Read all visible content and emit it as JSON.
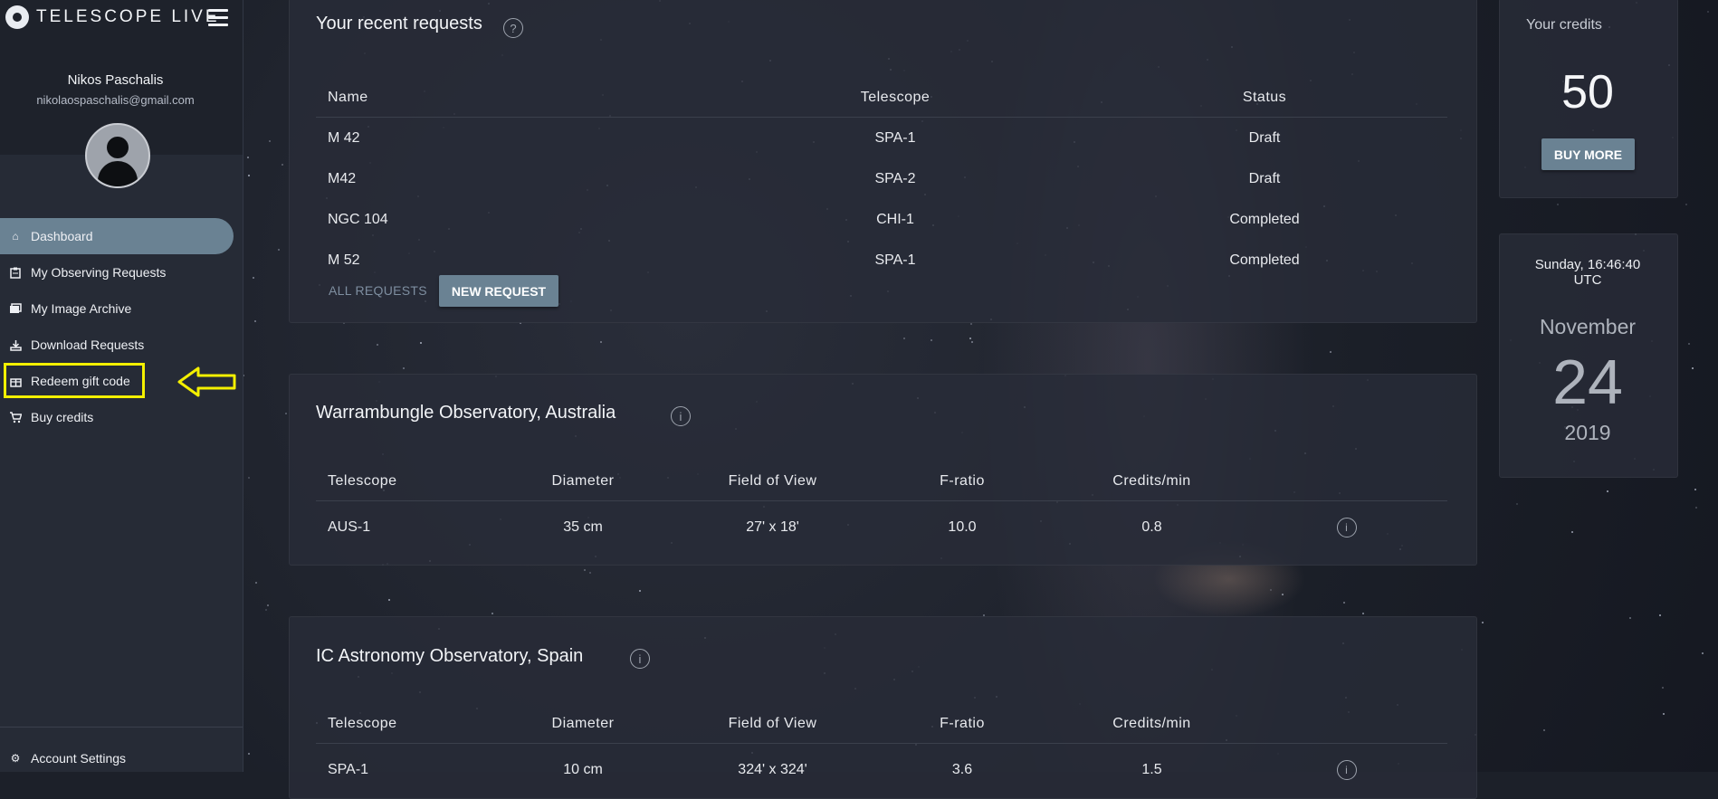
{
  "app": {
    "logo_text": "TELESCOPE LIVE"
  },
  "user": {
    "name": "Nikos Paschalis",
    "email": "nikolaospaschalis@gmail.com"
  },
  "nav": {
    "items": [
      {
        "label": "Dashboard",
        "icon": "home-icon"
      },
      {
        "label": "My Observing Requests",
        "icon": "clipboard-icon"
      },
      {
        "label": "My Image Archive",
        "icon": "images-icon"
      },
      {
        "label": "Download Requests",
        "icon": "download-icon"
      },
      {
        "label": "Redeem gift code",
        "icon": "gift-icon"
      },
      {
        "label": "Buy credits",
        "icon": "cart-icon"
      }
    ],
    "account_settings": "Account Settings"
  },
  "recent": {
    "title": "Your recent requests",
    "columns": [
      "Name",
      "Telescope",
      "Status"
    ],
    "rows": [
      [
        "M 42",
        "SPA-1",
        "Draft"
      ],
      [
        "M42",
        "SPA-2",
        "Draft"
      ],
      [
        "NGC 104",
        "CHI-1",
        "Completed"
      ],
      [
        "M 52",
        "SPA-1",
        "Completed"
      ]
    ],
    "all_requests": "ALL REQUESTS",
    "new_request": "NEW REQUEST"
  },
  "observatories": [
    {
      "title": "Warrambungle Observatory, Australia",
      "columns": [
        "Telescope",
        "Diameter",
        "Field of View",
        "F-ratio",
        "Credits/min"
      ],
      "rows": [
        [
          "AUS-1",
          "35 cm",
          "27' x 18'",
          "10.0",
          "0.8"
        ]
      ]
    },
    {
      "title": "IC Astronomy Observatory, Spain",
      "columns": [
        "Telescope",
        "Diameter",
        "Field of View",
        "F-ratio",
        "Credits/min"
      ],
      "rows": [
        [
          "SPA-1",
          "10 cm",
          "324' x 324'",
          "3.6",
          "1.5"
        ]
      ]
    }
  ],
  "credits": {
    "label": "Your credits",
    "value": "50",
    "buy_more": "BUY MORE"
  },
  "clock": {
    "day_time": "Sunday, 16:46:40",
    "tz": "UTC",
    "month": "November",
    "day": "24",
    "year": "2019"
  },
  "colors": {
    "accent": "#6a8293",
    "highlight": "#f4f000"
  }
}
